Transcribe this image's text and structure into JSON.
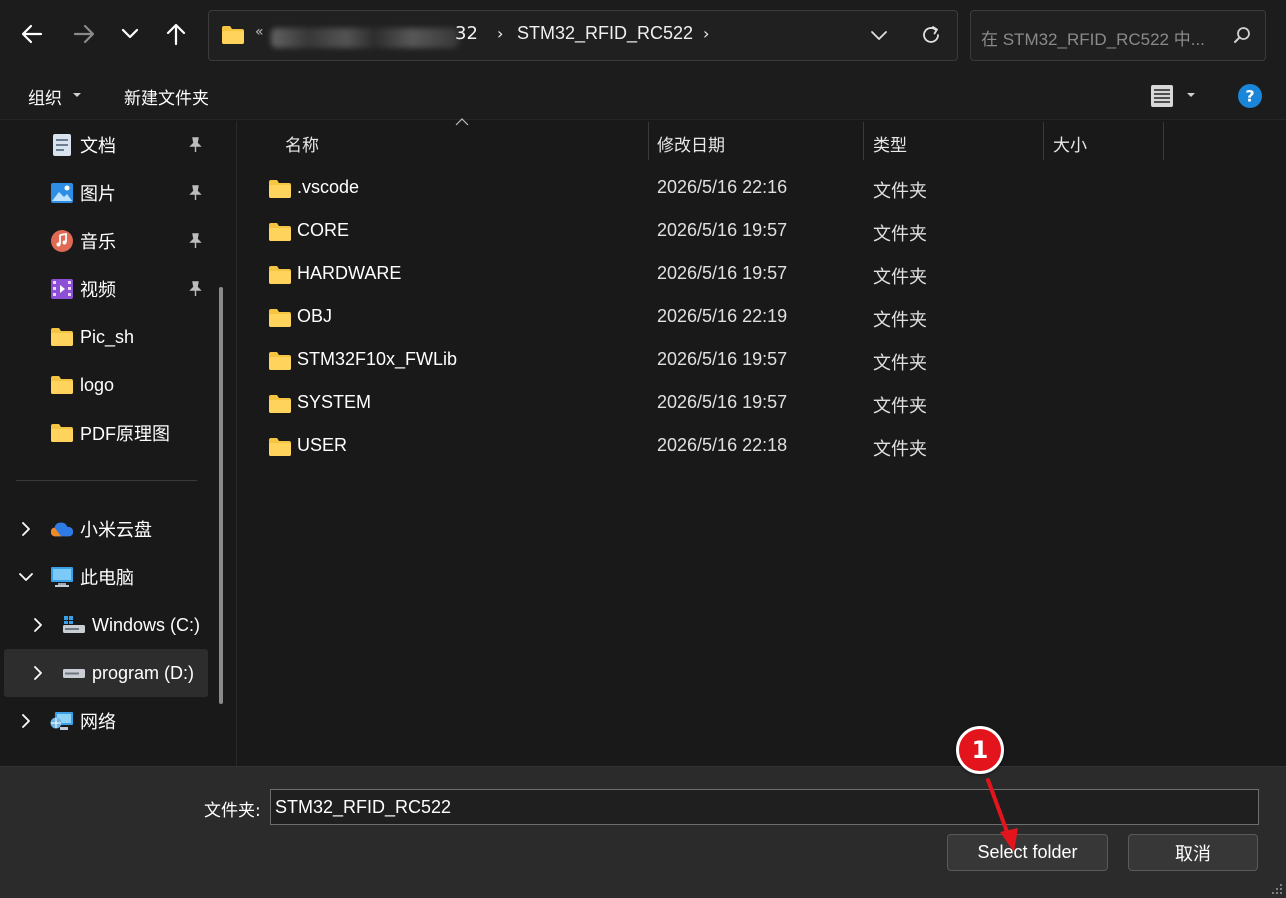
{
  "colors": {
    "background": "#191919",
    "bar": "#1c1c1c",
    "footer": "#2b2b2b",
    "folder_yellow": "#f5c542",
    "annotation_red": "#e3141b",
    "help_blue": "#1a86d9"
  },
  "nav": {
    "back_icon": "arrow-left-icon",
    "forward_icon": "arrow-right-icon",
    "recent_icon": "chevron-down-icon",
    "up_icon": "arrow-up-icon"
  },
  "address": {
    "overflow": "«",
    "parent_visible": "32",
    "separator": "›",
    "current": "STM32_RFID_RC522"
  },
  "search": {
    "placeholder": "在 STM32_RFID_RC522 中..."
  },
  "toolbar": {
    "organize_label": "组织",
    "new_folder_label": "新建文件夹"
  },
  "sidebar": {
    "quick_access": [
      {
        "label": "文档",
        "icon": "documents-icon",
        "pinned": true
      },
      {
        "label": "图片",
        "icon": "pictures-icon",
        "pinned": true
      },
      {
        "label": "音乐",
        "icon": "music-icon",
        "pinned": true
      },
      {
        "label": "视频",
        "icon": "videos-icon",
        "pinned": true
      },
      {
        "label": "Pic_sh",
        "icon": "folder-icon",
        "pinned": false
      },
      {
        "label": "logo",
        "icon": "folder-icon",
        "pinned": false
      },
      {
        "label": "PDF原理图",
        "icon": "folder-icon",
        "pinned": false
      }
    ],
    "tree": [
      {
        "label": "小米云盘",
        "icon": "cloud-icon",
        "expanded": false
      },
      {
        "label": "此电脑",
        "icon": "this-pc-icon",
        "expanded": true
      },
      {
        "label": "Windows (C:)",
        "icon": "drive-c-icon",
        "expanded": false
      },
      {
        "label": "program (D:)",
        "icon": "drive-d-icon",
        "expanded": false,
        "selected": true
      },
      {
        "label": "网络",
        "icon": "network-icon",
        "expanded": false
      }
    ]
  },
  "columns": {
    "name": "名称",
    "date": "修改日期",
    "type": "类型",
    "size": "大小"
  },
  "files": [
    {
      "name": ".vscode",
      "date": "2026/5/16 22:16",
      "type": "文件夹"
    },
    {
      "name": "CORE",
      "date": "2026/5/16 19:57",
      "type": "文件夹"
    },
    {
      "name": "HARDWARE",
      "date": "2026/5/16 19:57",
      "type": "文件夹"
    },
    {
      "name": "OBJ",
      "date": "2026/5/16 22:19",
      "type": "文件夹"
    },
    {
      "name": "STM32F10x_FWLib",
      "date": "2026/5/16 19:57",
      "type": "文件夹"
    },
    {
      "name": "SYSTEM",
      "date": "2026/5/16 19:57",
      "type": "文件夹"
    },
    {
      "name": "USER",
      "date": "2026/5/16 22:18",
      "type": "文件夹"
    }
  ],
  "footer": {
    "folder_label": "文件夹:",
    "folder_value": "STM32_RFID_RC522",
    "select_label": "Select folder",
    "cancel_label": "取消"
  },
  "annotation": {
    "number": "1"
  }
}
